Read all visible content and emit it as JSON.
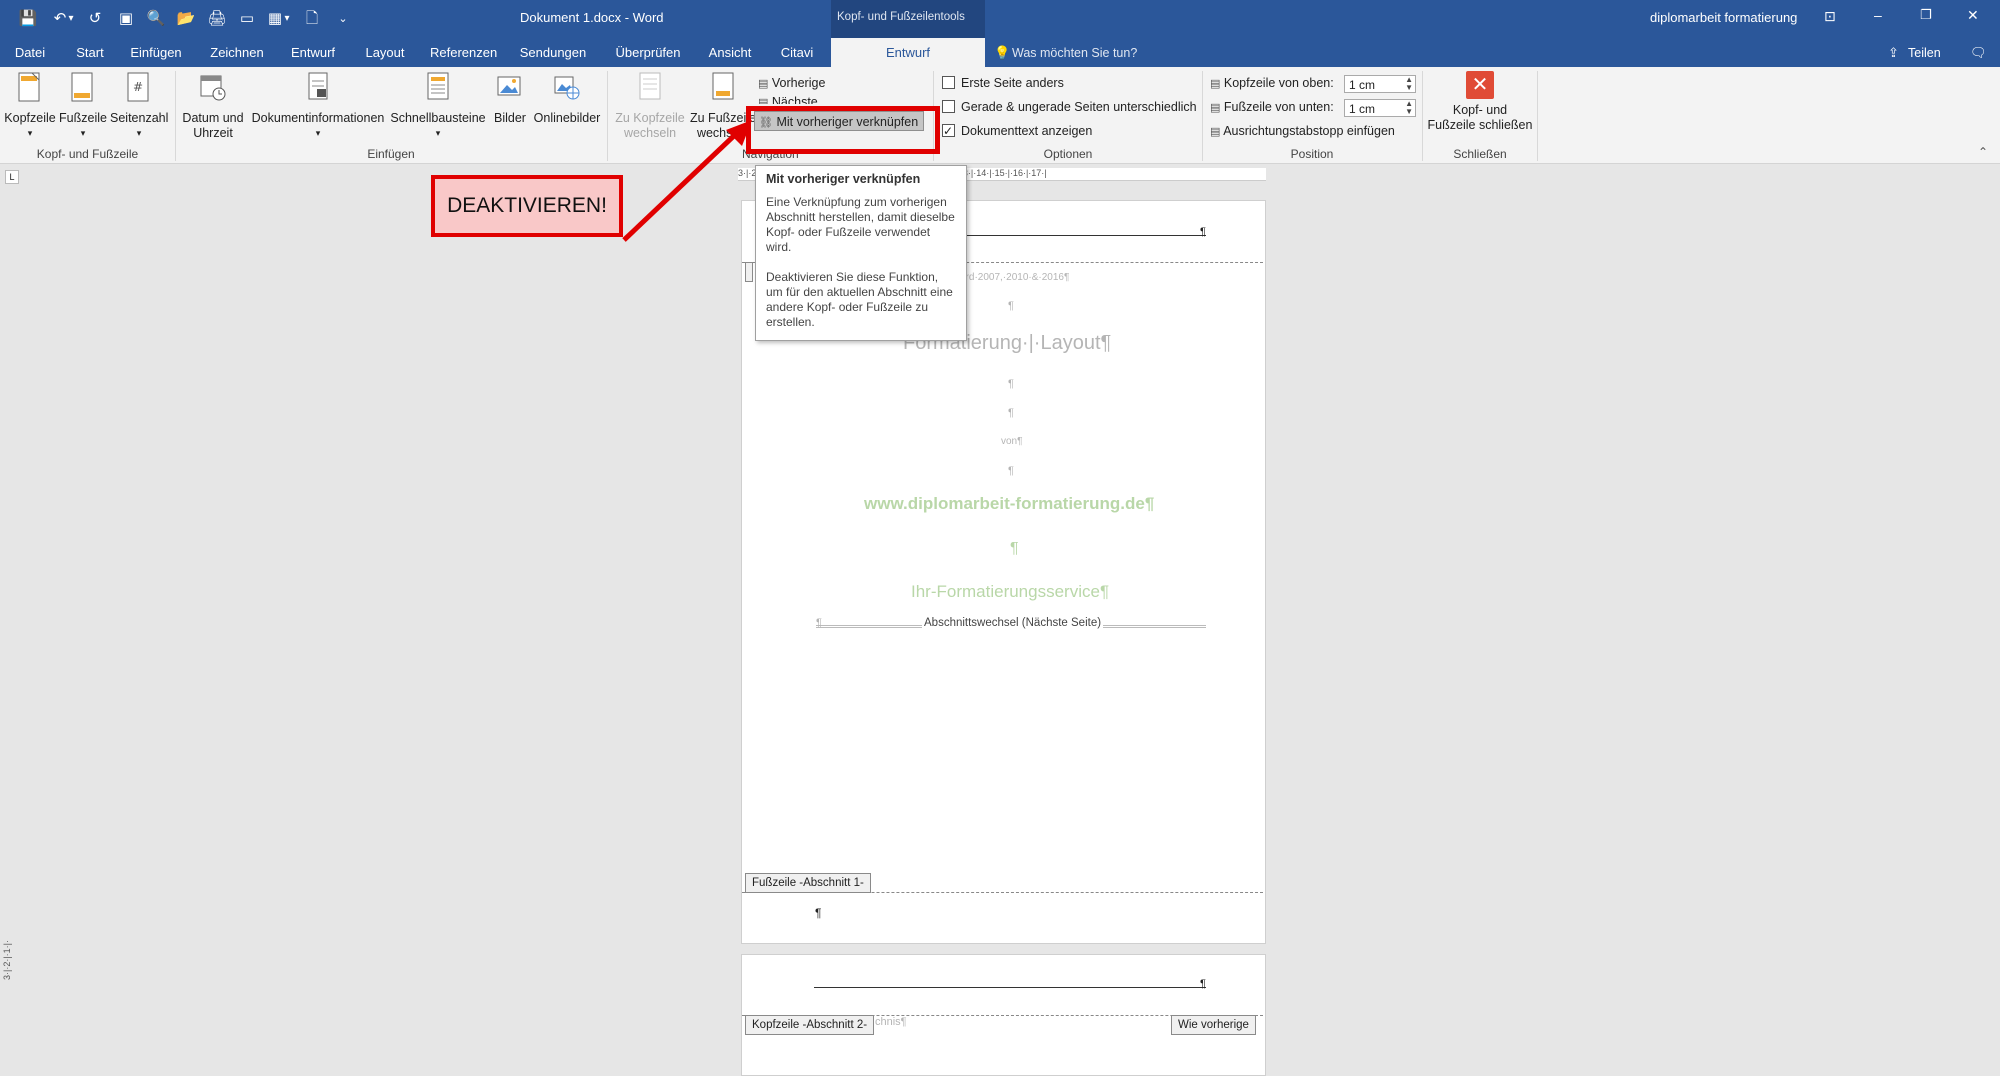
{
  "window": {
    "title": "Dokument 1.docx  -  Word",
    "context_tools": "Kopf- und Fußzeilentools",
    "search_term": "diplomarbeit formatierung",
    "controls": {
      "ribbon_display": "⊡",
      "minimize": "–",
      "restore": "❐",
      "close": "✕"
    }
  },
  "qat": {
    "save": "💾",
    "undo": "↶",
    "undo_menu": "▾",
    "redo": "↺",
    "save2": "▣",
    "preview": "🔍",
    "open": "📂",
    "print": "🖨",
    "view": "▭",
    "table": "▦",
    "table_menu": "▾",
    "new": "🗋",
    "customize": "⌄"
  },
  "tabs": [
    "Datei",
    "Start",
    "Einfügen",
    "Zeichnen",
    "Entwurf",
    "Layout",
    "Referenzen",
    "Sendungen",
    "Überprüfen",
    "Ansicht",
    "Citavi",
    "Entwurf"
  ],
  "tellme": "Was möchten Sie tun?",
  "share": "Teilen",
  "ribbon": {
    "group_hf": {
      "label": "Kopf- und Fußzeile",
      "kopfzeile": "Kopfzeile",
      "fusszeile": "Fußzeile",
      "seitenzahl": "Seitenzahl"
    },
    "group_insert": {
      "label": "Einfügen",
      "datum1": "Datum und",
      "datum2": "Uhrzeit",
      "dokinfo": "Dokumentinformationen",
      "schnell": "Schnellbausteine",
      "bilder": "Bilder",
      "online": "Onlinebilder"
    },
    "group_nav": {
      "label": "Navigation",
      "zu_kopf1": "Zu Kopfzeile",
      "zu_kopf2": "wechseln",
      "zu_fuss1": "Zu Fußzeile",
      "zu_fuss2": "wechseln",
      "vorherige": "Vorherige",
      "naechste": "Nächste",
      "link_prev": "Mit vorheriger verknüpfen"
    },
    "group_options": {
      "label": "Optionen",
      "erste": "Erste Seite anders",
      "gerade": "Gerade & ungerade Seiten unterschiedlich",
      "doktext": "Dokumenttext anzeigen"
    },
    "group_position": {
      "label": "Position",
      "kopf_oben": "Kopfzeile von oben:",
      "kopf_val": "1 cm",
      "fuss_unten": "Fußzeile von unten:",
      "fuss_val": "1 cm",
      "tab": "Ausrichtungstabstopp einfügen"
    },
    "group_close": {
      "label": "Schließen",
      "close1": "Kopf- und",
      "close2": "Fußzeile schließen"
    }
  },
  "ruler_text": "3·|·2·|·1·|·   ·1·|·2·|·3·|·4·|·5·|·6·|·7·|·8·|·9·|·10·|·11·|·12·|·13·|·14·|·15·|·16·|·17·|",
  "annotation": "DEAKTIVIEREN!",
  "tooltip": {
    "title": "Mit vorheriger verknüpfen",
    "p1": "Eine Verknüpfung zum vorherigen Abschnitt herstellen, damit dieselbe Kopf- oder Fußzeile verwendet wird.",
    "p2": "Deaktivieren Sie diese Funktion, um für den aktuellen Abschnitt eine andere Kopf- oder Fußzeile zu erstellen."
  },
  "page1": {
    "small_line": "ord·2007,·2010·&·2016¶",
    "pilcrow": "¶",
    "heading": "Formatierung·|·Layout¶",
    "von": "von¶",
    "website": "www.diplomarbeit-formatierung.de¶",
    "service": "Ihr-Formatierungsservice¶",
    "section_break": "Abschnittswechsel (Nächste Seite)",
    "footer_tag": "Fußzeile -Abschnitt 1-"
  },
  "page2": {
    "header_tag": "Kopfzeile -Abschnitt 2-",
    "same_tag": "Wie vorherige",
    "faded_text": "chnis¶"
  }
}
